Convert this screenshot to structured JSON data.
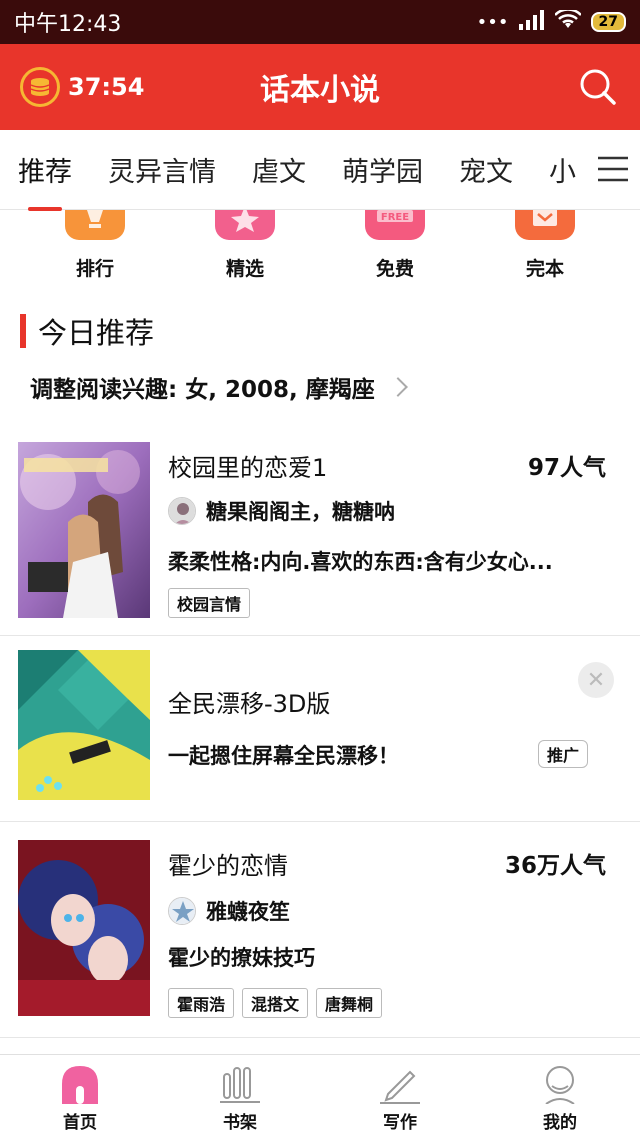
{
  "status": {
    "time": "中午12:43",
    "signal": "•••",
    "battery": "27"
  },
  "header": {
    "timer": "37:54",
    "title": "话本小说"
  },
  "tabs": [
    "推荐",
    "灵异言情",
    "虐文",
    "萌学园",
    "宠文",
    "小"
  ],
  "shortcuts": [
    {
      "label": "排行",
      "color": "#f7943a"
    },
    {
      "label": "精选",
      "color": "#f2608d"
    },
    {
      "label": "免费",
      "color": "#f45a7f"
    },
    {
      "label": "完本",
      "color": "#f46b3d"
    }
  ],
  "section": {
    "title": "今日推荐",
    "interest": "调整阅读兴趣: 女, 2008, 摩羯座"
  },
  "books": [
    {
      "title": "校园里的恋爱1",
      "popularity": "97人气",
      "authors": "糖果阁阁主，糖糖呐",
      "desc": "柔柔性格:内向.喜欢的东西:含有少女心...",
      "tags": [
        "校园言情"
      ]
    },
    {
      "title": "全民漂移-3D版",
      "desc": "一起摁住屏幕全民漂移！",
      "badge": "推广"
    },
    {
      "title": "霍少的恋情",
      "popularity": "36万人气",
      "authors": "雅蠛夜笙",
      "desc": "霍少的撩妹技巧",
      "tags": [
        "霍雨浩",
        "混搭文",
        "唐舞桐"
      ]
    }
  ],
  "nav": [
    {
      "label": "首页",
      "active": true
    },
    {
      "label": "书架"
    },
    {
      "label": "写作"
    },
    {
      "label": "我的"
    }
  ],
  "colors": {
    "brand": "#e8352b",
    "status_bar": "#3a0b0b"
  }
}
